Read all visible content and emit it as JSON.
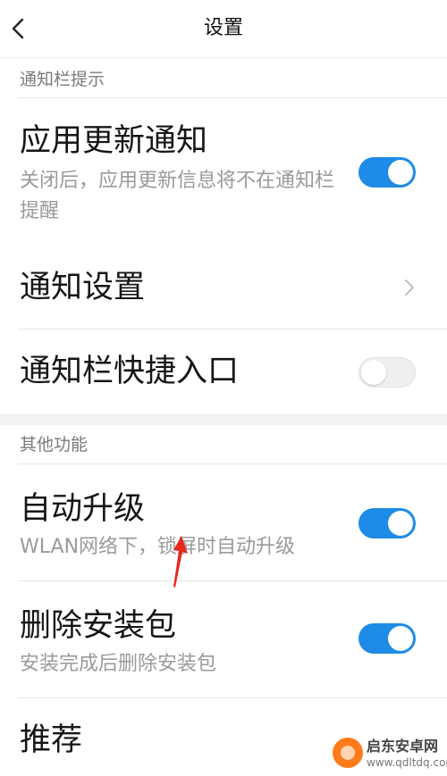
{
  "header": {
    "title": "设置"
  },
  "sections": [
    {
      "label": "通知栏提示",
      "items": [
        {
          "title": "应用更新通知",
          "subtitle": "关闭后，应用更新信息将不在通知栏提醒",
          "control": "toggle",
          "on": true
        },
        {
          "title": "通知设置",
          "control": "chevron"
        },
        {
          "title": "通知栏快捷入口",
          "control": "toggle",
          "on": false
        }
      ]
    },
    {
      "label": "其他功能",
      "items": [
        {
          "title": "自动升级",
          "subtitle": "WLAN网络下，锁屏时自动升级",
          "control": "toggle",
          "on": true
        },
        {
          "title": "删除安装包",
          "subtitle": "安装完成后删除安装包",
          "control": "toggle",
          "on": true
        },
        {
          "title": "推荐",
          "control": "toggle"
        }
      ]
    }
  ],
  "watermark": {
    "name": "启东安卓网",
    "url": "www.qdltdq.com"
  },
  "colors": {
    "accent": "#1e8be6",
    "annotation_arrow": "#e8281e",
    "section_gap": "#f2f2f2"
  }
}
